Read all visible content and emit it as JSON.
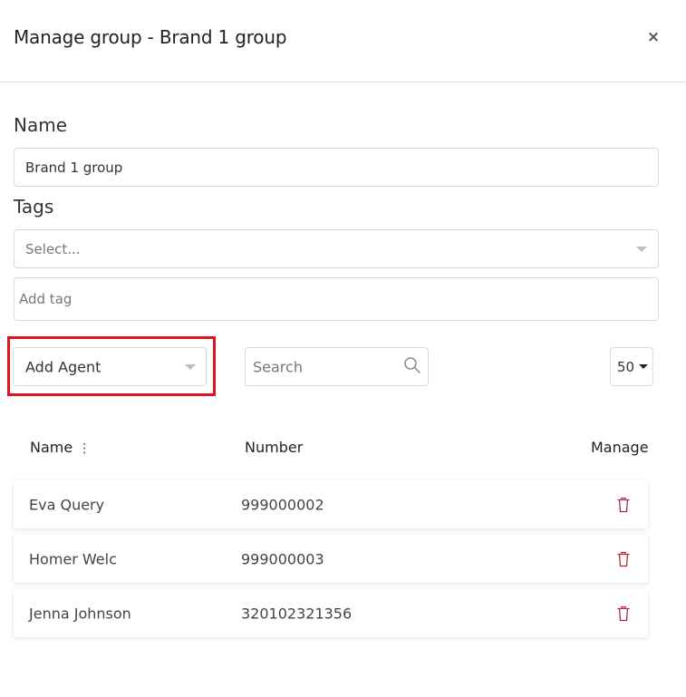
{
  "dialog": {
    "title": "Manage group - Brand 1 group",
    "close_glyph": "×"
  },
  "name_section": {
    "label": "Name",
    "value": "Brand 1 group"
  },
  "tags_section": {
    "label": "Tags",
    "select_placeholder": "Select...",
    "add_tag_placeholder": "Add tag"
  },
  "toolbar": {
    "add_agent_label": "Add Agent",
    "search_placeholder": "Search",
    "page_size": "50"
  },
  "table": {
    "headers": {
      "name": "Name",
      "number": "Number",
      "manage": "Manage"
    },
    "sort_glyph": "⋮",
    "rows": [
      {
        "name": "Eva Query",
        "number": "999000002"
      },
      {
        "name": "Homer Welc",
        "number": "999000003"
      },
      {
        "name": "Jenna Johnson",
        "number": "320102321356"
      }
    ]
  },
  "icons": {
    "close": "close-icon",
    "select_arrow": "chevron-down-icon",
    "search": "search-icon",
    "sort": "sort-icon",
    "delete": "trash-icon"
  },
  "colors": {
    "highlight": "#e1141c",
    "delete_icon": "#b5293f"
  }
}
